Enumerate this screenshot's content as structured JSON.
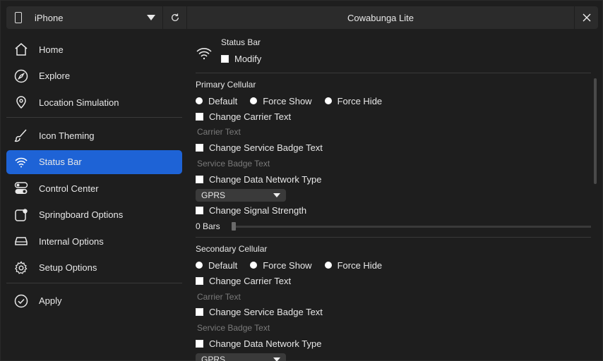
{
  "topbar": {
    "device": "iPhone",
    "title": "Cowabunga Lite",
    "phone_icon": "phone-icon",
    "refresh_icon": "refresh-icon",
    "close_icon": "close-icon"
  },
  "sidebar": {
    "items": [
      {
        "label": "Home",
        "icon": "home-icon"
      },
      {
        "label": "Explore",
        "icon": "compass-icon"
      },
      {
        "label": "Location Simulation",
        "icon": "location-pin-icon"
      },
      {
        "label": "Icon Theming",
        "icon": "brush-icon"
      },
      {
        "label": "Status Bar",
        "icon": "wifi-icon",
        "active": true
      },
      {
        "label": "Control Center",
        "icon": "toggles-icon"
      },
      {
        "label": "Springboard Options",
        "icon": "springboard-icon"
      },
      {
        "label": "Internal Options",
        "icon": "drive-icon"
      },
      {
        "label": "Setup Options",
        "icon": "gear-icon"
      },
      {
        "label": "Apply",
        "icon": "checkmark-circle-icon"
      }
    ]
  },
  "content": {
    "header_title": "Status Bar",
    "modify_label": "Modify",
    "primary": {
      "title": "Primary Cellular",
      "radio_default": "Default",
      "radio_force_show": "Force Show",
      "radio_force_hide": "Force Hide",
      "change_carrier": "Change Carrier Text",
      "carrier_placeholder": "Carrier Text",
      "change_badge": "Change Service Badge Text",
      "badge_placeholder": "Service Badge Text",
      "change_network": "Change Data Network Type",
      "network_value": "GPRS",
      "change_signal": "Change Signal Strength",
      "signal_value": "0 Bars"
    },
    "secondary": {
      "title": "Secondary Cellular",
      "radio_default": "Default",
      "radio_force_show": "Force Show",
      "radio_force_hide": "Force Hide",
      "change_carrier": "Change Carrier Text",
      "carrier_placeholder": "Carrier Text",
      "change_badge": "Change Service Badge Text",
      "badge_placeholder": "Service Badge Text",
      "change_network": "Change Data Network Type",
      "network_value": "GPRS"
    }
  },
  "colors": {
    "accent": "#1e63d6",
    "background": "#1e1e1e",
    "panel": "#2b2b2b"
  }
}
